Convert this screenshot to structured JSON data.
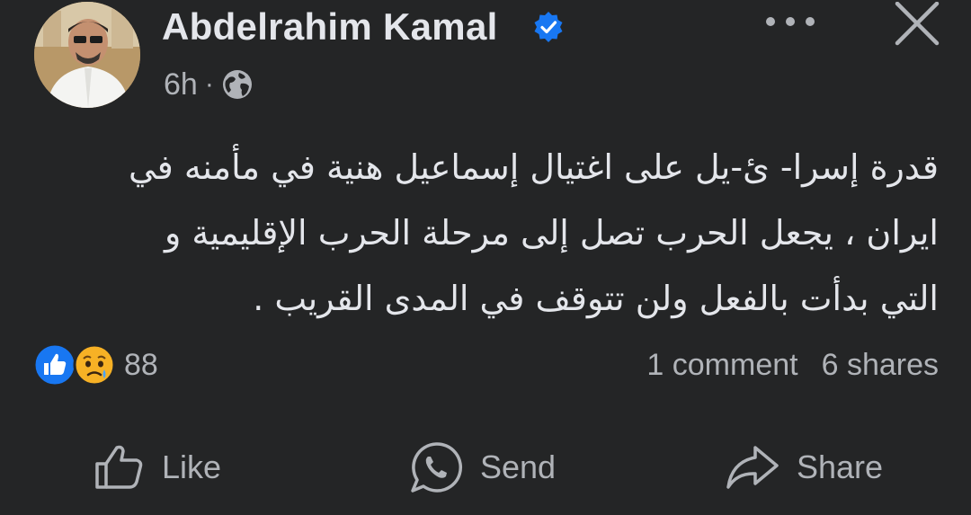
{
  "post": {
    "author": "Abdelrahim Kamal",
    "time": "6h",
    "separator": "·",
    "text_lines": [
      "قدرة  إسرا- ئ-يل على اغتيال إسماعيل هنية في مأمنه في",
      "ايران  ، يجعل الحرب تصل إلى مرحلة الحرب الإقليمية  و",
      "التي بدأت بالفعل  ولن تتوقف في المدى القريب ."
    ]
  },
  "reactions": {
    "count": "88",
    "types": [
      "like-icon",
      "sad-icon"
    ]
  },
  "stats": {
    "comments": "1 comment",
    "shares": "6 shares"
  },
  "actions": {
    "like": "Like",
    "send": "Send",
    "share": "Share"
  },
  "header_icons": [
    "verified-badge-icon",
    "globe-icon",
    "more-options-icon",
    "close-icon"
  ],
  "colors": {
    "background": "#242526",
    "primary_text": "#e4e6eb",
    "secondary_text": "#b0b3b8",
    "accent_blue": "#1877f2"
  }
}
